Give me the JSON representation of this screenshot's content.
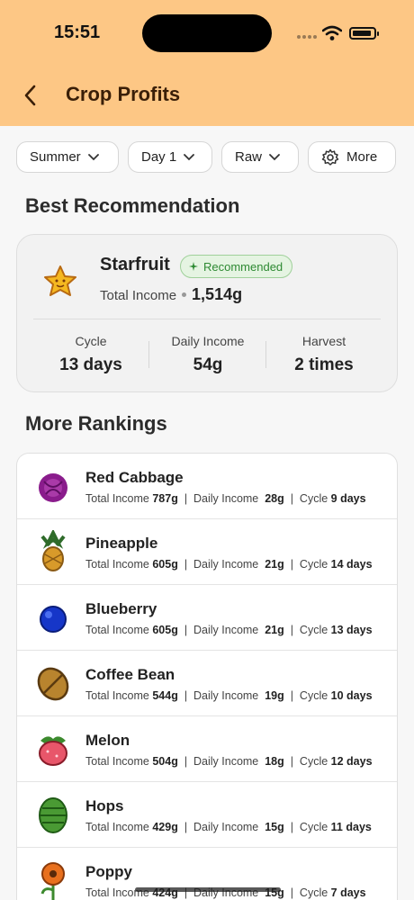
{
  "status_bar": {
    "time": "15:51"
  },
  "nav": {
    "title": "Crop Profits"
  },
  "filters": [
    {
      "label": "Summer"
    },
    {
      "label": "Day 1"
    },
    {
      "label": "Raw"
    },
    {
      "label": "More"
    }
  ],
  "best": {
    "heading": "Best Recommendation",
    "name": "Starfruit",
    "badge": "Recommended",
    "income_label": "Total Income",
    "income_value": "1,514g",
    "stats": [
      {
        "label": "Cycle",
        "value": "13 days"
      },
      {
        "label": "Daily Income",
        "value": "54g"
      },
      {
        "label": "Harvest",
        "value": "2 times"
      }
    ]
  },
  "rankings": {
    "heading": "More Rankings",
    "labels": {
      "total": "Total Income",
      "daily": "Daily Income",
      "cycle": "Cycle",
      "sep": "|"
    },
    "items": [
      {
        "name": "Red Cabbage",
        "total": "787g",
        "daily": "28g",
        "cycle": "9 days",
        "icon": "red-cabbage-icon"
      },
      {
        "name": "Pineapple",
        "total": "605g",
        "daily": "21g",
        "cycle": "14 days",
        "icon": "pineapple-icon"
      },
      {
        "name": "Blueberry",
        "total": "605g",
        "daily": "21g",
        "cycle": "13 days",
        "icon": "blueberry-icon"
      },
      {
        "name": "Coffee Bean",
        "total": "544g",
        "daily": "19g",
        "cycle": "10 days",
        "icon": "coffee-bean-icon"
      },
      {
        "name": "Melon",
        "total": "504g",
        "daily": "18g",
        "cycle": "12 days",
        "icon": "melon-icon"
      },
      {
        "name": "Hops",
        "total": "429g",
        "daily": "15g",
        "cycle": "11 days",
        "icon": "hops-icon"
      },
      {
        "name": "Poppy",
        "total": "424g",
        "daily": "15g",
        "cycle": "7 days",
        "icon": "poppy-icon"
      }
    ]
  },
  "colors": {
    "header_bg": "#fdc785",
    "title": "#3a1f08",
    "badge_green": "#2e8a33"
  }
}
